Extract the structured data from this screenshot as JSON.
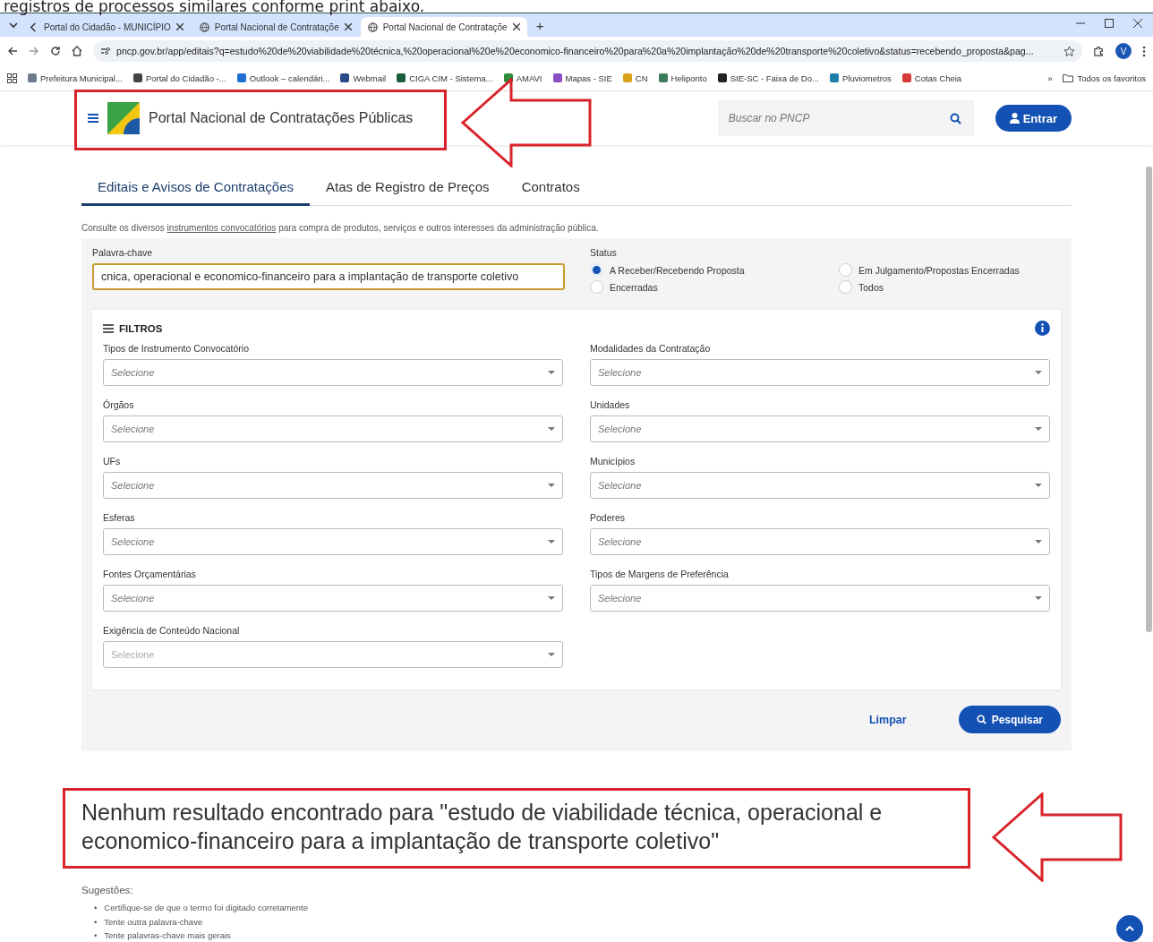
{
  "caption": "registros de processos similares conforme print abaixo.",
  "browser": {
    "tabs": [
      {
        "title": "Portal do Cidadão - MUNICÍPIO",
        "selected": false
      },
      {
        "title": "Portal Nacional de Contrataçõe",
        "selected": false
      },
      {
        "title": "Portal Nacional de Contrataçõe",
        "selected": true
      }
    ],
    "new_tab": "+",
    "url": "pncp.gov.br/app/editais?q=estudo%20de%20viabilidade%20técnica,%20operacional%20e%20economico-financeiro%20para%20a%20implantação%20de%20transporte%20coletivo&status=recebendo_proposta&pag...",
    "profile": "V",
    "bookmarks": [
      {
        "title": "Prefeitura Municipal...",
        "color": "#6b7b8c"
      },
      {
        "title": "Portal do Cidadão -...",
        "color": "#444444"
      },
      {
        "title": "Outlook – calendári...",
        "color": "#1f6fd1"
      },
      {
        "title": "Webmail",
        "color": "#2b4a8a"
      },
      {
        "title": "CIGA CIM - Sistema...",
        "color": "#1b5e3a"
      },
      {
        "title": "AMAVI",
        "color": "#2e8b3a"
      },
      {
        "title": "Mapas - SIE",
        "color": "#8a4fc2"
      },
      {
        "title": "CN",
        "color": "#d9a21b"
      },
      {
        "title": "Heliponto",
        "color": "#3c7d5a"
      },
      {
        "title": "SIE-SC - Faixa de Do...",
        "color": "#222222"
      },
      {
        "title": "Pluviometros",
        "color": "#1e7fa8"
      },
      {
        "title": "Cotas Cheia",
        "color": "#d93a3a"
      }
    ],
    "overflow": "»",
    "all_bookmarks": "Todos os favoritos"
  },
  "header": {
    "title": "Portal Nacional de Contratações Públicas",
    "search": {
      "placeholder": "Buscar no PNCP"
    },
    "login": "Entrar"
  },
  "nav_tabs": [
    {
      "label": "Editais e Avisos de Contratações",
      "selected": true
    },
    {
      "label": "Atas de Registro de Preços",
      "selected": false
    },
    {
      "label": "Contratos",
      "selected": false
    }
  ],
  "intro": {
    "before": "Consulte os diversos",
    "link": "instrumentos convocatórios",
    "after": "para compra de produtos, serviços e outros interesses da administração pública."
  },
  "keyword": {
    "label": "Palavra-chave",
    "value": "cnica, operacional e economico-financeiro para a implantação de transporte coletivo"
  },
  "status": {
    "label": "Status",
    "options": [
      {
        "label": "A Receber/Recebendo Proposta",
        "selected": true
      },
      {
        "label": "Em Julgamento/Propostas Encerradas",
        "selected": false
      },
      {
        "label": "Encerradas",
        "selected": false
      },
      {
        "label": "Todos",
        "selected": false
      }
    ]
  },
  "filters": {
    "title": "FILTROS",
    "fields": [
      {
        "label": "Tipos de Instrumento Convocatório",
        "placeholder": "Selecione",
        "disabled": false
      },
      {
        "label": "Modalidades da Contratação",
        "placeholder": "Selecione",
        "disabled": false
      },
      {
        "label": "Órgãos",
        "placeholder": "Selecione",
        "disabled": false
      },
      {
        "label": "Unidades",
        "placeholder": "Selecione",
        "disabled": false
      },
      {
        "label": "UFs",
        "placeholder": "Selecione",
        "disabled": false
      },
      {
        "label": "Municípios",
        "placeholder": "Selecione",
        "disabled": false
      },
      {
        "label": "Esferas",
        "placeholder": "Selecione",
        "disabled": false
      },
      {
        "label": "Poderes",
        "placeholder": "Selecione",
        "disabled": false
      },
      {
        "label": "Fontes Orçamentárias",
        "placeholder": "Selecione",
        "disabled": false
      },
      {
        "label": "Tipos de Margens de Preferência",
        "placeholder": "Selecione",
        "disabled": false
      },
      {
        "label": "Exigência de Conteúdo Nacional",
        "placeholder": "Selecione",
        "disabled": true
      }
    ]
  },
  "actions": {
    "clear": "Limpar",
    "search": "Pesquisar"
  },
  "result": {
    "heading": "Nenhum resultado encontrado para \"estudo de viabilidade técnica, operacional e economico-financeiro para a implantação de transporte coletivo\"",
    "suggestions_label": "Sugestões:",
    "bullet": "•",
    "suggestions": [
      "Certifique-se de que o termo foi digitado corretamente",
      "Tente outra palavra-chave",
      "Tente palavras-chave mais gerais"
    ]
  }
}
